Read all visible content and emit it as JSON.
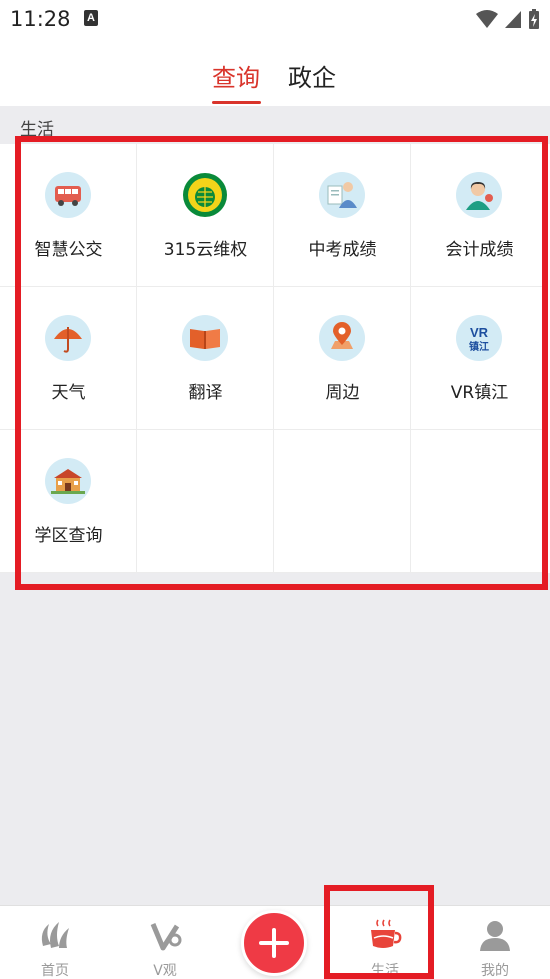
{
  "status_bar": {
    "time": "11:28",
    "notification_letter": "A"
  },
  "header": {
    "tabs": [
      {
        "label": "查询",
        "active": true
      },
      {
        "label": "政企",
        "active": false
      }
    ]
  },
  "section": {
    "label": "生活"
  },
  "services": [
    {
      "label": "智慧公交",
      "icon": "bus-icon"
    },
    {
      "label": "315云维权",
      "icon": "consumer-rights-icon"
    },
    {
      "label": "中考成绩",
      "icon": "exam-score-icon"
    },
    {
      "label": "会计成绩",
      "icon": "accountant-score-icon"
    },
    {
      "label": "天气",
      "icon": "umbrella-icon"
    },
    {
      "label": "翻译",
      "icon": "book-icon"
    },
    {
      "label": "周边",
      "icon": "location-pin-icon"
    },
    {
      "label": "VR镇江",
      "icon": "vr-icon"
    },
    {
      "label": "学区查询",
      "icon": "school-icon"
    }
  ],
  "vr_badge_text": "镇江",
  "bottom_nav": {
    "items": [
      {
        "label": "首页",
        "icon": "home-logo-icon",
        "active": false
      },
      {
        "label": "V观",
        "icon": "v-icon",
        "active": false
      },
      {
        "label": "",
        "icon": "plus-icon",
        "active": false
      },
      {
        "label": "生活",
        "icon": "cup-icon",
        "active": true
      },
      {
        "label": "我的",
        "icon": "profile-icon",
        "active": false
      }
    ]
  },
  "colors": {
    "accent": "#d9342b",
    "highlight_border": "#e41c24",
    "icon_background": "#d3ebf5",
    "plus_button": "#ef3a45"
  }
}
